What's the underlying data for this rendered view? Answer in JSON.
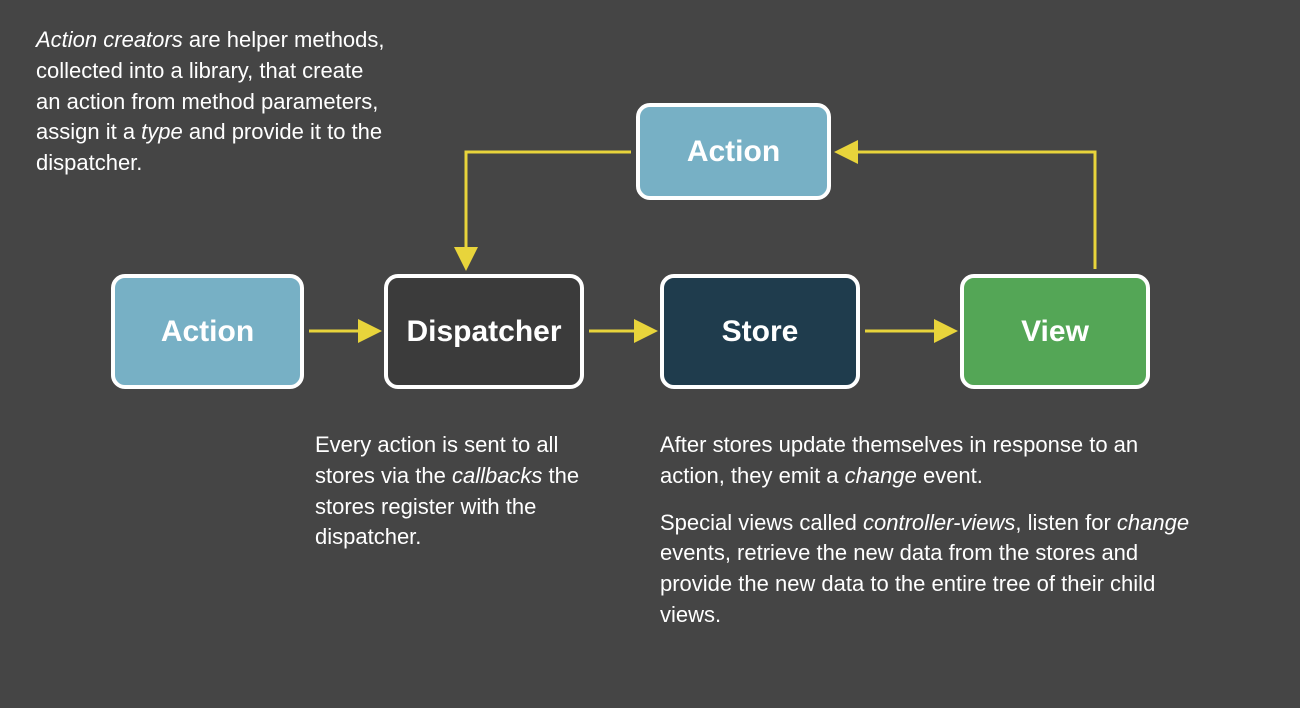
{
  "boxes": {
    "action_top": "Action",
    "action_left": "Action",
    "dispatcher": "Dispatcher",
    "store": "Store",
    "view": "View"
  },
  "descriptions": {
    "action_creators_html": "<em>Action creators</em> are helper methods, collected into a library, that create an action from method parameters, assign it a <em>type</em> and provide it to the dispatcher.",
    "dispatcher_html": "Every action is sent to all stores via the <em>callbacks</em> the stores register with the dispatcher.",
    "store_p1_html": "After stores update themselves in response to an action, they emit a <em>change</em> event.",
    "store_p2_html": "Special views called <em>controller-views</em>, listen for <em>change</em> events, retrieve the new data from the stores and provide the new data to the entire tree of their child views."
  },
  "colors": {
    "background": "#454545",
    "box_border": "#ffffff",
    "action_bg": "#77b0c5",
    "dispatcher_bg": "#3b3b3b",
    "store_bg": "#1f3c4d",
    "view_bg": "#54a656",
    "arrow": "#e8d43b"
  },
  "diagram": {
    "nodes": [
      {
        "id": "action-top",
        "label": "Action"
      },
      {
        "id": "action-left",
        "label": "Action"
      },
      {
        "id": "dispatcher",
        "label": "Dispatcher"
      },
      {
        "id": "store",
        "label": "Store"
      },
      {
        "id": "view",
        "label": "View"
      }
    ],
    "edges": [
      {
        "from": "action-left",
        "to": "dispatcher"
      },
      {
        "from": "dispatcher",
        "to": "store"
      },
      {
        "from": "store",
        "to": "view"
      },
      {
        "from": "action-top",
        "to": "dispatcher"
      },
      {
        "from": "view",
        "to": "action-top"
      }
    ]
  }
}
